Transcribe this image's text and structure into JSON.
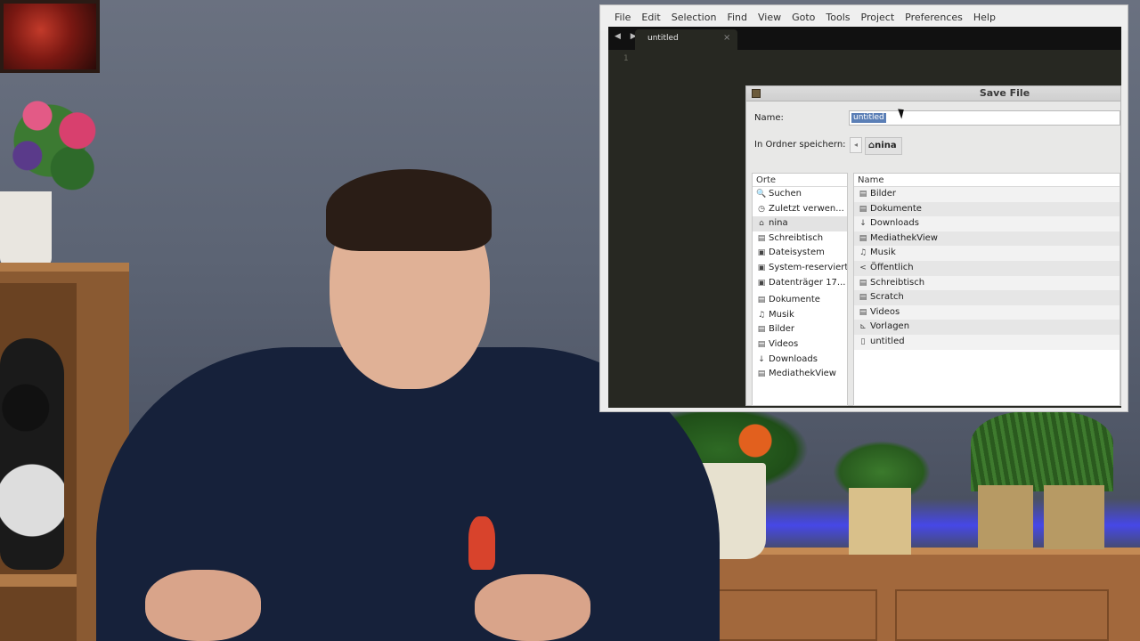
{
  "menu": [
    "File",
    "Edit",
    "Selection",
    "Find",
    "View",
    "Goto",
    "Tools",
    "Project",
    "Preferences",
    "Help"
  ],
  "editor": {
    "tab_title": "untitled",
    "tab_close": "×",
    "tab_arrows": "◀ ▶",
    "line_number": "1"
  },
  "dialog": {
    "title": "Save File",
    "name_label": "Name:",
    "name_value": "untitled",
    "folder_label": "In Ordner speichern:",
    "path_back": "◂",
    "path_current": "nina",
    "places_header": "Orte",
    "places": [
      {
        "icon": "search-icon",
        "glyph": "🔍",
        "label": "Suchen"
      },
      {
        "icon": "recent-clock-icon",
        "glyph": "◷",
        "label": "Zuletzt verwen..."
      },
      {
        "icon": "home-icon",
        "glyph": "⌂",
        "label": "nina"
      },
      {
        "icon": "desktop-icon",
        "glyph": "▤",
        "label": "Schreibtisch"
      },
      {
        "icon": "drive-icon",
        "glyph": "▣",
        "label": "Dateisystem"
      },
      {
        "icon": "drive-icon",
        "glyph": "▣",
        "label": "System-reserviert"
      },
      {
        "icon": "drive-icon",
        "glyph": "▣",
        "label": "Datenträger 17..."
      },
      {
        "icon": "folder-icon",
        "glyph": "▤",
        "label": "Dokumente"
      },
      {
        "icon": "music-icon",
        "glyph": "♫",
        "label": "Musik"
      },
      {
        "icon": "pictures-icon",
        "glyph": "▤",
        "label": "Bilder"
      },
      {
        "icon": "videos-icon",
        "glyph": "▤",
        "label": "Videos"
      },
      {
        "icon": "download-icon",
        "glyph": "↓",
        "label": "Downloads"
      },
      {
        "icon": "folder-icon",
        "glyph": "▤",
        "label": "MediathekView"
      }
    ],
    "files_header": "Name",
    "files": [
      {
        "icon": "folder-icon",
        "glyph": "▤",
        "label": "Bilder"
      },
      {
        "icon": "folder-icon",
        "glyph": "▤",
        "label": "Dokumente"
      },
      {
        "icon": "download-icon",
        "glyph": "↓",
        "label": "Downloads"
      },
      {
        "icon": "folder-icon",
        "glyph": "▤",
        "label": "MediathekView"
      },
      {
        "icon": "music-icon",
        "glyph": "♫",
        "label": "Musik"
      },
      {
        "icon": "share-icon",
        "glyph": "<",
        "label": "Öffentlich"
      },
      {
        "icon": "folder-icon",
        "glyph": "▤",
        "label": "Schreibtisch"
      },
      {
        "icon": "folder-icon",
        "glyph": "▤",
        "label": "Scratch"
      },
      {
        "icon": "videos-icon",
        "glyph": "▤",
        "label": "Videos"
      },
      {
        "icon": "templates-icon",
        "glyph": "⊾",
        "label": "Vorlagen"
      },
      {
        "icon": "file-icon",
        "glyph": "▯",
        "label": "untitled"
      }
    ]
  }
}
